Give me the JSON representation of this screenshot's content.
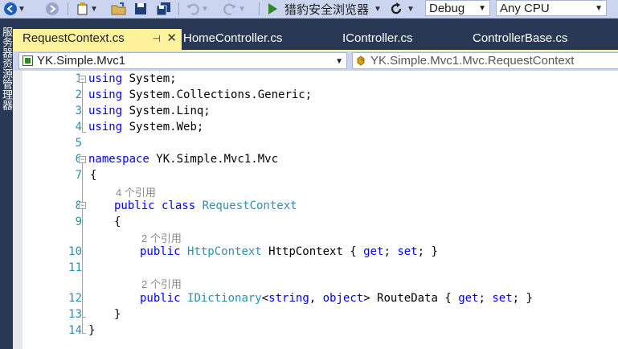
{
  "toolbar": {
    "start_label": "猎豹安全浏览器",
    "config_value": "Debug",
    "platform_value": "Any CPU"
  },
  "sidebar": {
    "label": "服务器资源管理器"
  },
  "tabs": [
    {
      "label": "RequestContext.cs",
      "active": true
    },
    {
      "label": "HomeController.cs"
    },
    {
      "label": "IController.cs"
    },
    {
      "label": "ControllerBase.cs"
    }
  ],
  "navbar": {
    "project": "YK.Simple.Mvc1",
    "type": "YK.Simple.Mvc1.Mvc.RequestContext"
  },
  "code": {
    "line_numbers": [
      "1",
      "2",
      "3",
      "4",
      "5",
      "6",
      "7",
      "8",
      "9",
      "10",
      "11",
      "12",
      "13",
      "14"
    ],
    "using1_kw": "using",
    "using1_ns": " System;",
    "using2_kw": "using",
    "using2_ns": " System.Collections.Generic;",
    "using3_kw": "using",
    "using3_ns": " System.Linq;",
    "using4_kw": "using",
    "using4_ns": " System.Web;",
    "ns_kw": "namespace",
    "ns_name": " YK.Simple.Mvc1.Mvc",
    "open_brace": "{",
    "class_ref": "4 个引用",
    "class_mod": "public class ",
    "class_name": "RequestContext",
    "class_open": "{",
    "prop1_ref": "2 个引用",
    "prop1_mod": "public ",
    "prop1_type": "HttpContext",
    "prop1_name": " HttpContext { ",
    "prop1_get": "get",
    "prop1_sep": "; ",
    "prop1_set": "set",
    "prop1_end": "; }",
    "prop2_ref": "2 个引用",
    "prop2_mod": "public ",
    "prop2_type": "IDictionary",
    "prop2_lt": "<",
    "prop2_t1": "string",
    "prop2_comma": ", ",
    "prop2_t2": "object",
    "prop2_gt": "> RouteData { ",
    "prop2_get": "get",
    "prop2_sep": "; ",
    "prop2_set": "set",
    "prop2_end": "; }",
    "class_close": "}",
    "ns_close": "}"
  }
}
